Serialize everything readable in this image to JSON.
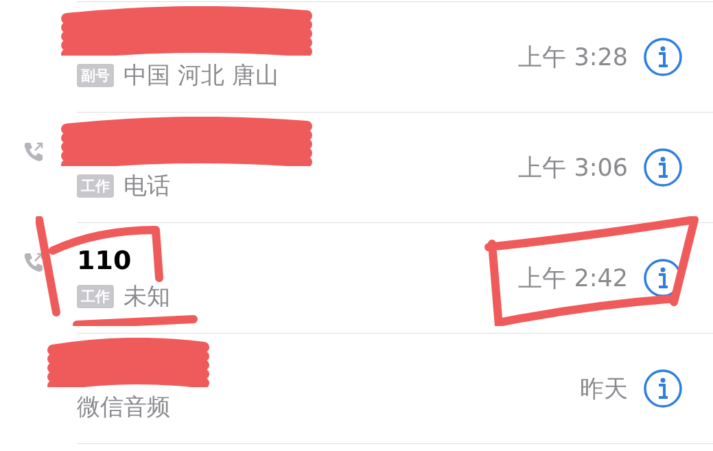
{
  "calls": [
    {
      "redacted": true,
      "outgoing": false,
      "badge": "副号",
      "detail": "中国 河北 唐山",
      "time": "上午 3:28",
      "circled": false
    },
    {
      "redacted": true,
      "outgoing": true,
      "badge": "工作",
      "detail": "电话",
      "time": "上午 3:06",
      "circled": false
    },
    {
      "name": "110",
      "redacted": false,
      "outgoing": true,
      "badge": "工作",
      "detail": "未知",
      "time": "上午 2:42",
      "circled": true
    },
    {
      "redacted": true,
      "outgoing": false,
      "detail": "微信音频",
      "time": "昨天",
      "circled": false
    }
  ]
}
